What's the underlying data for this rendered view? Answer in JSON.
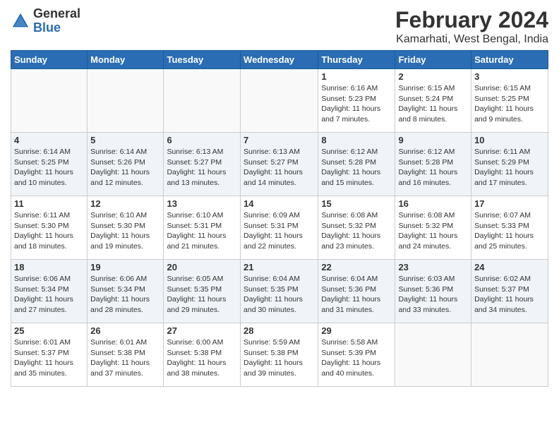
{
  "header": {
    "logo_line1": "General",
    "logo_line2": "Blue",
    "title": "February 2024",
    "subtitle": "Kamarhati, West Bengal, India"
  },
  "calendar": {
    "days_of_week": [
      "Sunday",
      "Monday",
      "Tuesday",
      "Wednesday",
      "Thursday",
      "Friday",
      "Saturday"
    ],
    "weeks": [
      {
        "alt": false,
        "days": [
          {
            "number": "",
            "info": ""
          },
          {
            "number": "",
            "info": ""
          },
          {
            "number": "",
            "info": ""
          },
          {
            "number": "",
            "info": ""
          },
          {
            "number": "1",
            "info": "Sunrise: 6:16 AM\nSunset: 5:23 PM\nDaylight: 11 hours\nand 7 minutes."
          },
          {
            "number": "2",
            "info": "Sunrise: 6:15 AM\nSunset: 5:24 PM\nDaylight: 11 hours\nand 8 minutes."
          },
          {
            "number": "3",
            "info": "Sunrise: 6:15 AM\nSunset: 5:25 PM\nDaylight: 11 hours\nand 9 minutes."
          }
        ]
      },
      {
        "alt": true,
        "days": [
          {
            "number": "4",
            "info": "Sunrise: 6:14 AM\nSunset: 5:25 PM\nDaylight: 11 hours\nand 10 minutes."
          },
          {
            "number": "5",
            "info": "Sunrise: 6:14 AM\nSunset: 5:26 PM\nDaylight: 11 hours\nand 12 minutes."
          },
          {
            "number": "6",
            "info": "Sunrise: 6:13 AM\nSunset: 5:27 PM\nDaylight: 11 hours\nand 13 minutes."
          },
          {
            "number": "7",
            "info": "Sunrise: 6:13 AM\nSunset: 5:27 PM\nDaylight: 11 hours\nand 14 minutes."
          },
          {
            "number": "8",
            "info": "Sunrise: 6:12 AM\nSunset: 5:28 PM\nDaylight: 11 hours\nand 15 minutes."
          },
          {
            "number": "9",
            "info": "Sunrise: 6:12 AM\nSunset: 5:28 PM\nDaylight: 11 hours\nand 16 minutes."
          },
          {
            "number": "10",
            "info": "Sunrise: 6:11 AM\nSunset: 5:29 PM\nDaylight: 11 hours\nand 17 minutes."
          }
        ]
      },
      {
        "alt": false,
        "days": [
          {
            "number": "11",
            "info": "Sunrise: 6:11 AM\nSunset: 5:30 PM\nDaylight: 11 hours\nand 18 minutes."
          },
          {
            "number": "12",
            "info": "Sunrise: 6:10 AM\nSunset: 5:30 PM\nDaylight: 11 hours\nand 19 minutes."
          },
          {
            "number": "13",
            "info": "Sunrise: 6:10 AM\nSunset: 5:31 PM\nDaylight: 11 hours\nand 21 minutes."
          },
          {
            "number": "14",
            "info": "Sunrise: 6:09 AM\nSunset: 5:31 PM\nDaylight: 11 hours\nand 22 minutes."
          },
          {
            "number": "15",
            "info": "Sunrise: 6:08 AM\nSunset: 5:32 PM\nDaylight: 11 hours\nand 23 minutes."
          },
          {
            "number": "16",
            "info": "Sunrise: 6:08 AM\nSunset: 5:32 PM\nDaylight: 11 hours\nand 24 minutes."
          },
          {
            "number": "17",
            "info": "Sunrise: 6:07 AM\nSunset: 5:33 PM\nDaylight: 11 hours\nand 25 minutes."
          }
        ]
      },
      {
        "alt": true,
        "days": [
          {
            "number": "18",
            "info": "Sunrise: 6:06 AM\nSunset: 5:34 PM\nDaylight: 11 hours\nand 27 minutes."
          },
          {
            "number": "19",
            "info": "Sunrise: 6:06 AM\nSunset: 5:34 PM\nDaylight: 11 hours\nand 28 minutes."
          },
          {
            "number": "20",
            "info": "Sunrise: 6:05 AM\nSunset: 5:35 PM\nDaylight: 11 hours\nand 29 minutes."
          },
          {
            "number": "21",
            "info": "Sunrise: 6:04 AM\nSunset: 5:35 PM\nDaylight: 11 hours\nand 30 minutes."
          },
          {
            "number": "22",
            "info": "Sunrise: 6:04 AM\nSunset: 5:36 PM\nDaylight: 11 hours\nand 31 minutes."
          },
          {
            "number": "23",
            "info": "Sunrise: 6:03 AM\nSunset: 5:36 PM\nDaylight: 11 hours\nand 33 minutes."
          },
          {
            "number": "24",
            "info": "Sunrise: 6:02 AM\nSunset: 5:37 PM\nDaylight: 11 hours\nand 34 minutes."
          }
        ]
      },
      {
        "alt": false,
        "days": [
          {
            "number": "25",
            "info": "Sunrise: 6:01 AM\nSunset: 5:37 PM\nDaylight: 11 hours\nand 35 minutes."
          },
          {
            "number": "26",
            "info": "Sunrise: 6:01 AM\nSunset: 5:38 PM\nDaylight: 11 hours\nand 37 minutes."
          },
          {
            "number": "27",
            "info": "Sunrise: 6:00 AM\nSunset: 5:38 PM\nDaylight: 11 hours\nand 38 minutes."
          },
          {
            "number": "28",
            "info": "Sunrise: 5:59 AM\nSunset: 5:38 PM\nDaylight: 11 hours\nand 39 minutes."
          },
          {
            "number": "29",
            "info": "Sunrise: 5:58 AM\nSunset: 5:39 PM\nDaylight: 11 hours\nand 40 minutes."
          },
          {
            "number": "",
            "info": ""
          },
          {
            "number": "",
            "info": ""
          }
        ]
      }
    ]
  }
}
